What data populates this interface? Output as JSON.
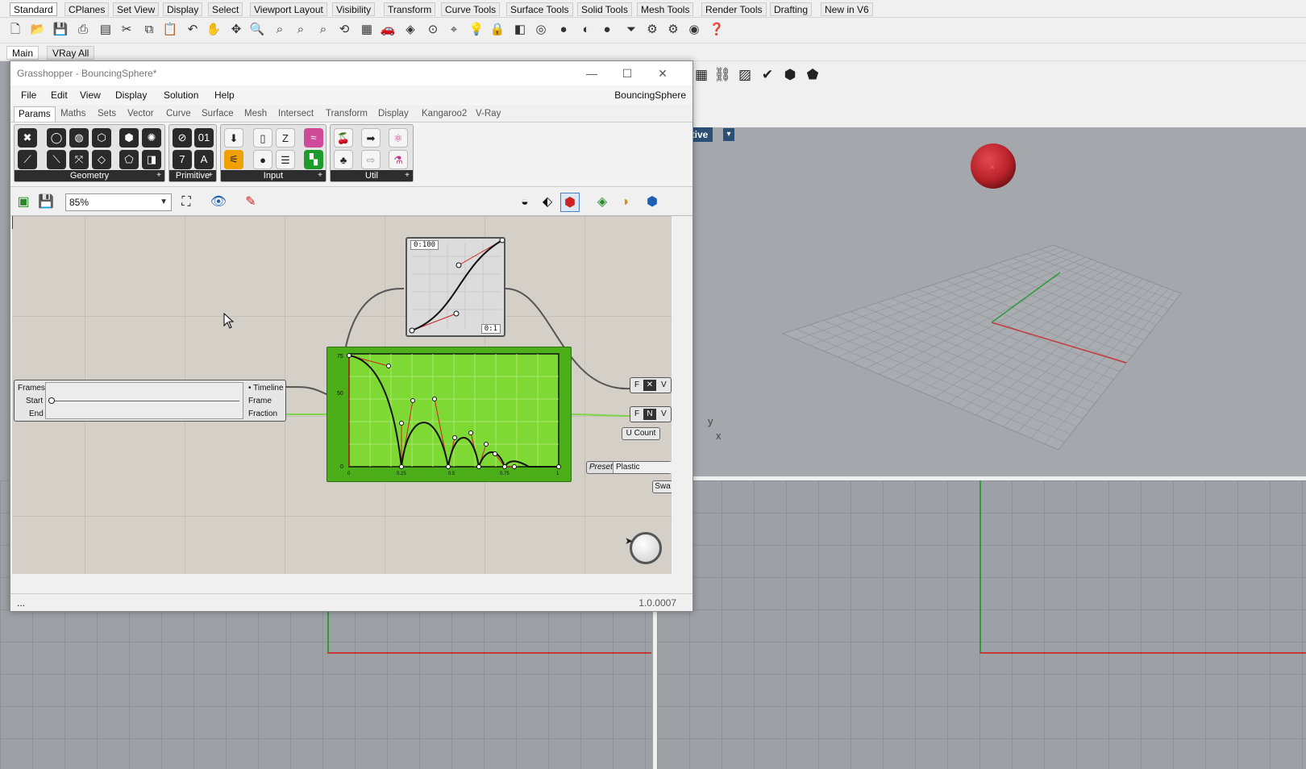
{
  "rhino": {
    "tabs": [
      "Standard",
      "CPlanes",
      "Set View",
      "Display",
      "Select",
      "Viewport Layout",
      "Visibility",
      "Transform",
      "Curve Tools",
      "Surface Tools",
      "Solid Tools",
      "Mesh Tools",
      "Render Tools",
      "Drafting",
      "New in V6"
    ],
    "sub_tabs": [
      "Main",
      "VRay All"
    ],
    "viewport_label": "ctive"
  },
  "gh": {
    "title": "Grasshopper - BouncingSphere*",
    "menu": [
      "File",
      "Edit",
      "View",
      "Display",
      "Solution",
      "Help"
    ],
    "doc_name": "BouncingSphere",
    "tabs": [
      "Params",
      "Maths",
      "Sets",
      "Vector",
      "Curve",
      "Surface",
      "Mesh",
      "Intersect",
      "Transform",
      "Display",
      "Kangaroo2",
      "V-Ray"
    ],
    "groups": [
      "Geometry",
      "Primitive",
      "Input",
      "Util"
    ],
    "zoom": "85%",
    "version": "1.0.0007",
    "status_left": "..."
  },
  "canvas": {
    "timeline": {
      "inputs": [
        "Frames",
        "Start",
        "End"
      ],
      "outputs": [
        "Timeline",
        "Frame",
        "Fraction"
      ]
    },
    "graph_small": {
      "top_label": "0:100",
      "bottom_label": "0:1"
    },
    "graph_big": {
      "y_ticks": [
        "75",
        "50",
        "0"
      ],
      "x_ticks": [
        "0",
        "0.25",
        "0.5",
        "0.75",
        "1"
      ]
    },
    "ports": {
      "f1": "F",
      "v1": "V",
      "f2": "F",
      "v2": "V",
      "u_count": "U Count",
      "preset": "Preset",
      "preset_value": "Plastic",
      "swap": "Swa"
    },
    "axis_y": "y",
    "axis_x": "x"
  },
  "colors": {
    "graph_green": "#7fd934",
    "viewport_label_bg": "#2c4f75",
    "sphere": "#c0262c"
  }
}
